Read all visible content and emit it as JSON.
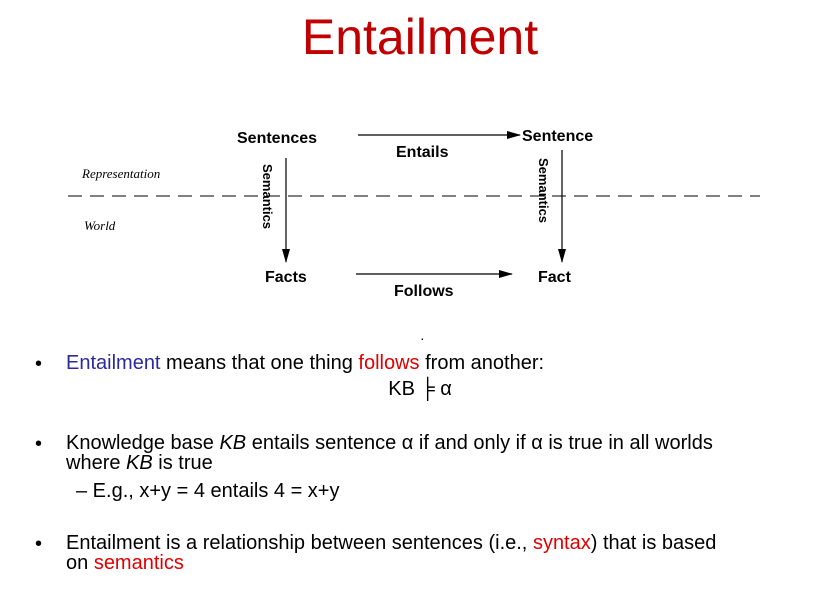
{
  "title": "Entailment",
  "diagram": {
    "sentences": "Sentences",
    "sentence": "Sentence",
    "entails": "Entails",
    "facts": "Facts",
    "fact": "Fact",
    "follows": "Follows",
    "semantics_left": "Semantics",
    "semantics_right": "Semantics",
    "representation": "Representation",
    "world": "World"
  },
  "bullets": {
    "b1": {
      "part1": "Entailment",
      "part2": " means that one thing ",
      "part3": "follows",
      "part4": " from another:",
      "formula": "KB ╞ α"
    },
    "b2": {
      "line1a": "Knowledge base ",
      "kb1": "KB",
      "line1b": " entails sentence α if and only if α is true in all worlds",
      "line2a": "where ",
      "kb2": "KB",
      "line2b": " is true",
      "example": "–  E.g., x+y = 4 entails  4 = x+y"
    },
    "b3": {
      "line1a": "Entailment is a relationship between sentences (i.e., ",
      "syntax": "syntax",
      "line1b": ") that is based",
      "line2a": "on ",
      "semantics": "semantics"
    },
    "marker": "•"
  },
  "colors": {
    "title": "#c00000",
    "highlight_red": "#e00000",
    "highlight_blue": "#2b2b9a"
  }
}
